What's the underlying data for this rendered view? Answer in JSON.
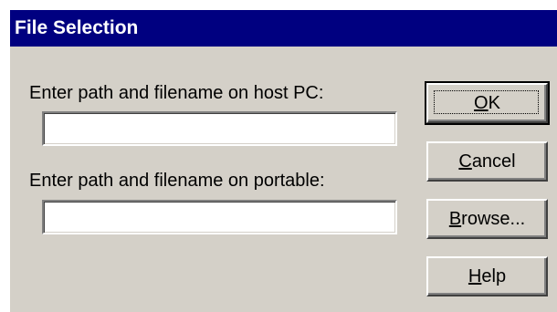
{
  "dialog": {
    "title": "File Selection",
    "host_label": "Enter path and filename on host PC:",
    "host_value": "",
    "portable_label": "Enter path and filename on portable:",
    "portable_value": ""
  },
  "buttons": {
    "ok": {
      "accel": "O",
      "rest": "K"
    },
    "cancel": {
      "accel": "C",
      "rest": "ancel"
    },
    "browse": {
      "accel": "B",
      "rest": "rowse..."
    },
    "help": {
      "accel": "H",
      "rest": "elp"
    }
  },
  "colors": {
    "titlebar": "#000080",
    "face": "#d4d0c8"
  }
}
